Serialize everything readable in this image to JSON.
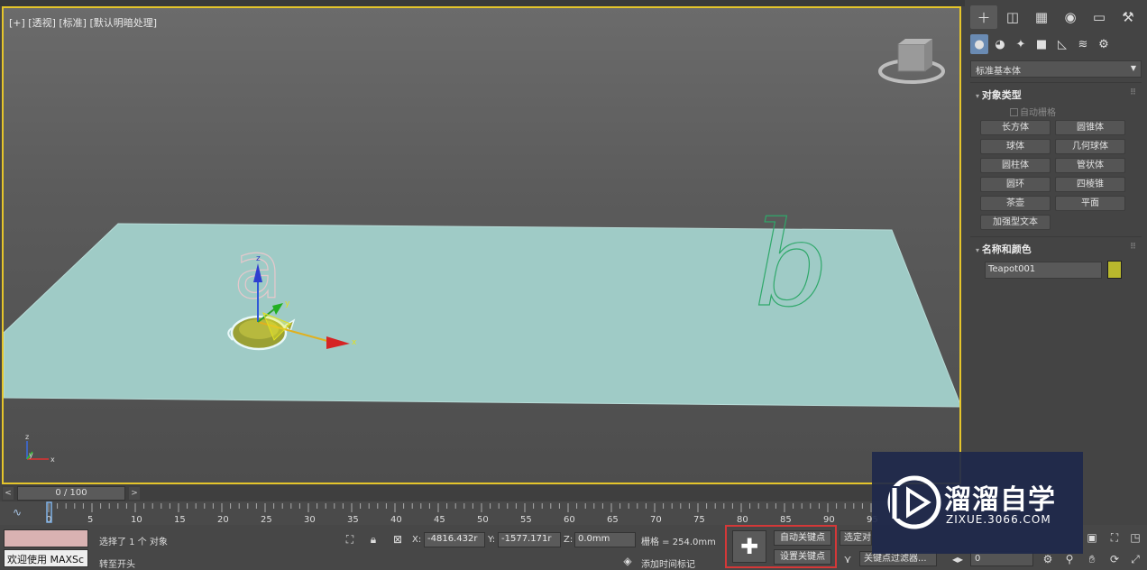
{
  "viewport": {
    "label": "[+] [透视] [标准] [默认明暗处理]",
    "object_letters": [
      "a",
      "b"
    ],
    "gizmo_axes": {
      "x": "x",
      "y": "y",
      "z": "z"
    }
  },
  "command_panel": {
    "tabs": [
      {
        "name": "create-tab",
        "icon": "plus-icon"
      },
      {
        "name": "modify-tab",
        "icon": "modify-icon"
      },
      {
        "name": "hierarchy-tab",
        "icon": "hierarchy-icon"
      },
      {
        "name": "motion-tab",
        "icon": "motion-icon"
      },
      {
        "name": "display-tab",
        "icon": "display-icon"
      },
      {
        "name": "utilities-tab",
        "icon": "wrench-icon"
      }
    ],
    "subtabs": [
      "geometry-icon",
      "shapes-icon",
      "lights-icon",
      "cameras-icon",
      "helpers-icon",
      "spacewarps-icon",
      "systems-icon"
    ],
    "category_dropdown": "标准基本体",
    "object_type": {
      "title": "对象类型",
      "auto_grid": "自动栅格",
      "buttons": [
        "长方体",
        "圆锥体",
        "球体",
        "几何球体",
        "圆柱体",
        "管状体",
        "圆环",
        "四棱锥",
        "茶壶",
        "平面",
        "加强型文本"
      ]
    },
    "name_color": {
      "title": "名称和颜色",
      "name_value": "Teapot001",
      "color": "#b9b82d"
    }
  },
  "time_slider": {
    "position": "0 / 100",
    "prev_label": "<",
    "next_label": ">"
  },
  "trackbar": {
    "ticks": [
      "0",
      "5",
      "10",
      "15",
      "20",
      "25",
      "30",
      "35",
      "40",
      "45",
      "50",
      "55",
      "60",
      "65",
      "70",
      "75",
      "80",
      "85",
      "90",
      "95"
    ]
  },
  "status_bar": {
    "welcome": "欢迎使用 MAXSc",
    "selection_text": "选择了 1 个 对象",
    "prompt_text": "转至开头",
    "x_label": "X:",
    "x_value": "-4816.432r",
    "y_label": "Y:",
    "y_value": "-1577.171r",
    "z_label": "Z:",
    "z_value": "0.0mm",
    "grid_text": "栅格 = 254.0mm",
    "add_time_tag": "添加时间标记",
    "auto_key": "自动关键点",
    "set_key": "设置关键点",
    "selected_label": "选定对",
    "key_filters": "关键点过滤器...",
    "frame_value": "0"
  },
  "watermark": {
    "title": "溜溜自学",
    "subtitle": "ZIXUE.3066.COM"
  }
}
